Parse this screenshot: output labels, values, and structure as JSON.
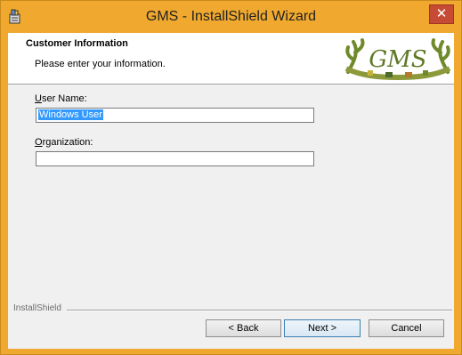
{
  "window": {
    "title": "GMS - InstallShield Wizard",
    "close_glyph": "✕"
  },
  "header": {
    "title": "Customer Information",
    "subtitle": "Please enter your information.",
    "logo_text": "GMS"
  },
  "form": {
    "user_name_label_accel": "U",
    "user_name_label_rest": "ser Name:",
    "user_name_value": "Windows User",
    "organization_label_accel": "O",
    "organization_label_rest": "rganization:",
    "organization_value": ""
  },
  "footer": {
    "brand": "InstallShield",
    "back_label": "< Back",
    "next_label": "Next >",
    "cancel_label": "Cancel"
  },
  "colors": {
    "window_frame": "#f0a92e",
    "close_button": "#c74a35",
    "selection": "#3399ff",
    "default_button_border": "#3c7fb1"
  },
  "icons": {
    "app": "installer-icon",
    "close": "close-icon"
  }
}
